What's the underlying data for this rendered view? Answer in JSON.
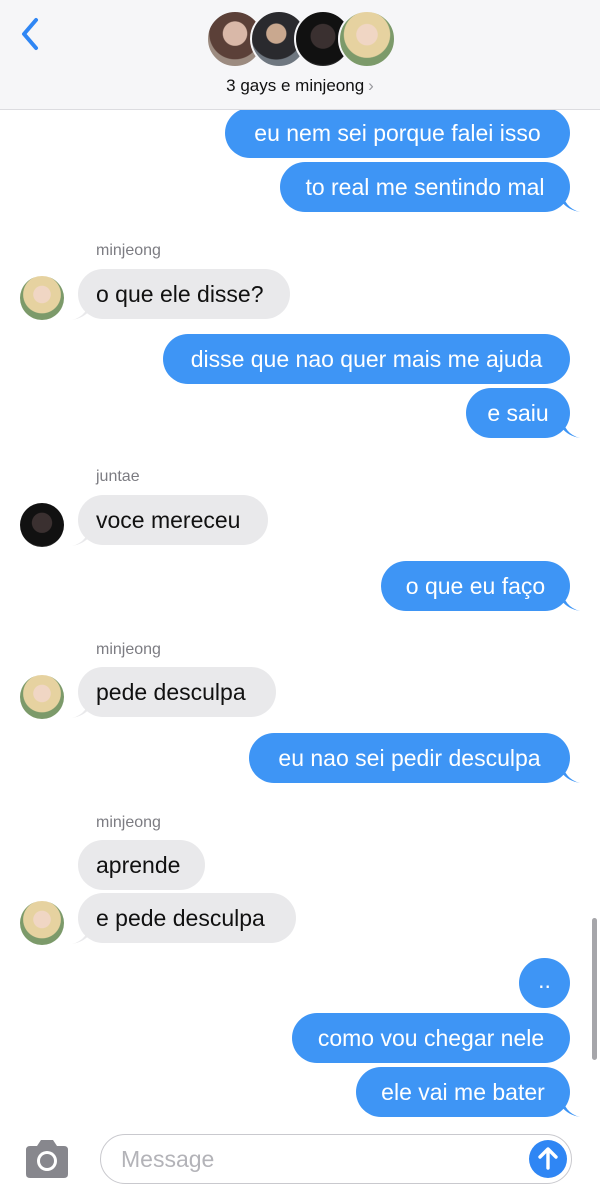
{
  "header": {
    "group_name": "3 gays e minjeong",
    "chevron": "›",
    "avatars": [
      "avatar-1",
      "avatar-2",
      "avatar-3",
      "avatar-4"
    ],
    "back_icon": "chevron-left-icon"
  },
  "messages": [
    {
      "text": "eu nem sei porque falei isso",
      "direction": "outgoing"
    },
    {
      "text": "to real me sentindo mal",
      "direction": "outgoing"
    },
    {
      "sender": "minjeong",
      "text": "o que ele disse?",
      "direction": "incoming"
    },
    {
      "text": "disse que nao quer mais me ajuda",
      "direction": "outgoing"
    },
    {
      "text": "e saiu",
      "direction": "outgoing"
    },
    {
      "sender": "juntae",
      "text": "voce mereceu",
      "direction": "incoming"
    },
    {
      "text": "o que eu faço",
      "direction": "outgoing"
    },
    {
      "sender": "minjeong",
      "text": "pede desculpa",
      "direction": "incoming"
    },
    {
      "text": "eu nao sei pedir desculpa",
      "direction": "outgoing"
    },
    {
      "sender": "minjeong",
      "text": "aprende",
      "direction": "incoming"
    },
    {
      "text": "e pede desculpa",
      "direction": "incoming"
    },
    {
      "text": "..",
      "direction": "outgoing"
    },
    {
      "text": "como vou chegar nele",
      "direction": "outgoing"
    },
    {
      "text": "ele vai me bater",
      "direction": "outgoing"
    }
  ],
  "senders": {
    "s1": "minjeong",
    "s2": "juntae",
    "s3": "minjeong",
    "s4": "minjeong"
  },
  "input": {
    "placeholder": "Message",
    "camera_icon": "camera-icon",
    "send_icon": "arrow-up-icon"
  },
  "colors": {
    "outgoing_bubble": "#3e95f5",
    "incoming_bubble": "#e9e9eb",
    "accent": "#2f86f4"
  }
}
